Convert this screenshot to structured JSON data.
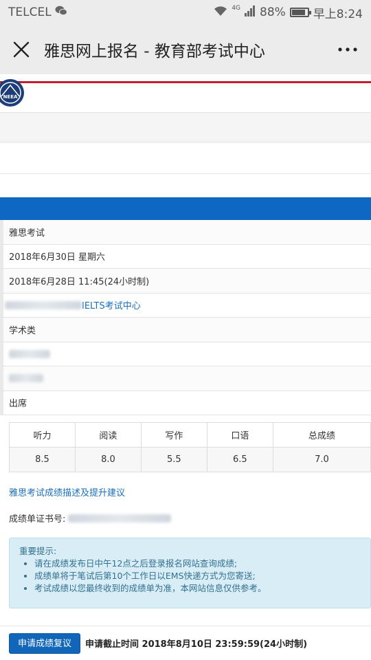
{
  "status_bar": {
    "carrier": "TELCEL",
    "network": "4G",
    "battery": "88%",
    "battery_level": 0.88,
    "time": "早上8:24"
  },
  "nav": {
    "title": "雅思网上报名 - 教育部考试中心"
  },
  "logo": {
    "text": "NEEA"
  },
  "rows": {
    "exam": "雅思考试",
    "date": "2018年6月30日 星期六",
    "release": "2018年6月28日 11:45(24小时制)",
    "center_suffix": "IELTS考试中心",
    "module": "学术类",
    "attendance": "出席"
  },
  "scores": {
    "headers": [
      "听力",
      "阅读",
      "写作",
      "口语",
      "总成绩"
    ],
    "values": [
      "8.5",
      "8.0",
      "5.5",
      "6.5",
      "7.0"
    ]
  },
  "links": {
    "description": "雅思考试成绩描述及提升建议"
  },
  "certificate": {
    "label": "成绩单证书号:"
  },
  "notice": {
    "title": "重要提示:",
    "items": [
      "请在成绩发布日中午12点之后登录报名网站查询成绩;",
      "成绩单将于笔试后第10个工作日以EMS快递方式为您寄送;",
      "考试成绩以您最终收到的成绩单为准，本网站信息仅供参考。"
    ]
  },
  "footer": {
    "button": "申请成绩复议",
    "deadline": "申请截止时间 2018年8月10日 23:59:59(24小时制)"
  },
  "colors": {
    "primary_blue": "#0f67c4",
    "link_blue": "#1a6fb8",
    "red_line": "#c41e2a",
    "notice_bg": "#d9edf7"
  }
}
